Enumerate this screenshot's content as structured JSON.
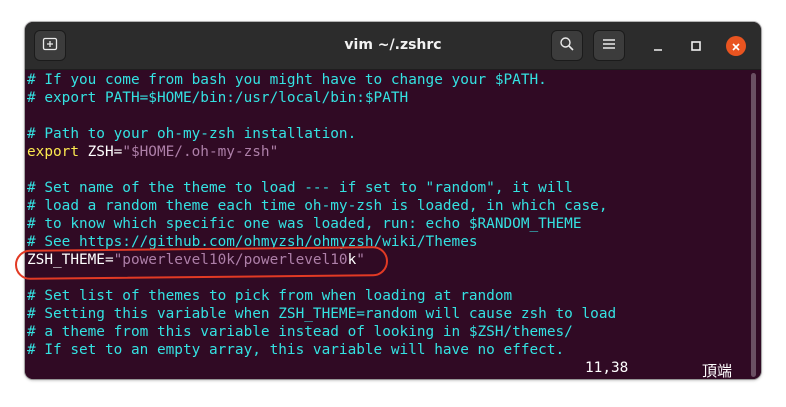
{
  "window": {
    "title": "vim ~/.zshrc",
    "buttons": [
      "new-tab-icon",
      "search-icon",
      "hamburger-menu-icon",
      "minimize-icon",
      "maximize-icon",
      "close-icon"
    ]
  },
  "editor": {
    "lines": [
      [
        {
          "t": "comment",
          "s": "# If you come from bash you might have to change your $PATH."
        }
      ],
      [
        {
          "t": "comment",
          "s": "# export PATH=$HOME/bin:/usr/local/bin:$PATH"
        }
      ],
      [
        {
          "t": "plain",
          "s": ""
        }
      ],
      [
        {
          "t": "comment",
          "s": "# Path to your oh-my-zsh installation."
        }
      ],
      [
        {
          "t": "keyword",
          "s": "export"
        },
        {
          "t": "plain",
          "s": " ZSH="
        },
        {
          "t": "string",
          "s": "\"$HOME/.oh-my-zsh\""
        }
      ],
      [
        {
          "t": "plain",
          "s": ""
        }
      ],
      [
        {
          "t": "comment",
          "s": "# Set name of the theme to load --- if set to \"random\", it will"
        }
      ],
      [
        {
          "t": "comment",
          "s": "# load a random theme each time oh-my-zsh is loaded, in which case,"
        }
      ],
      [
        {
          "t": "comment",
          "s": "# to know which specific one was loaded, run: echo $RANDOM_THEME"
        }
      ],
      [
        {
          "t": "comment",
          "s": "# See https://github.com/ohmyzsh/ohmyzsh/wiki/Themes"
        }
      ],
      [
        {
          "t": "plain",
          "s": "ZSH_THEME="
        },
        {
          "t": "string",
          "s": "\"powerlevel10k/powerlevel10"
        },
        {
          "t": "cursor",
          "s": "k"
        },
        {
          "t": "string",
          "s": "\""
        }
      ],
      [
        {
          "t": "plain",
          "s": ""
        }
      ],
      [
        {
          "t": "comment",
          "s": "# Set list of themes to pick from when loading at random"
        }
      ],
      [
        {
          "t": "comment",
          "s": "# Setting this variable when ZSH_THEME=random will cause zsh to load"
        }
      ],
      [
        {
          "t": "comment",
          "s": "# a theme from this variable instead of looking in $ZSH/themes/"
        }
      ],
      [
        {
          "t": "comment",
          "s": "# If set to an empty array, this variable will have no effect."
        }
      ]
    ],
    "status": {
      "position": "11,38",
      "scroll": "頂端"
    }
  },
  "colors": {
    "background": "#300a24",
    "comment": "#34e2e2",
    "keyword": "#fce94f",
    "string": "#ad7fa8",
    "annotation": "#e23a24",
    "close_button": "#e95420"
  }
}
